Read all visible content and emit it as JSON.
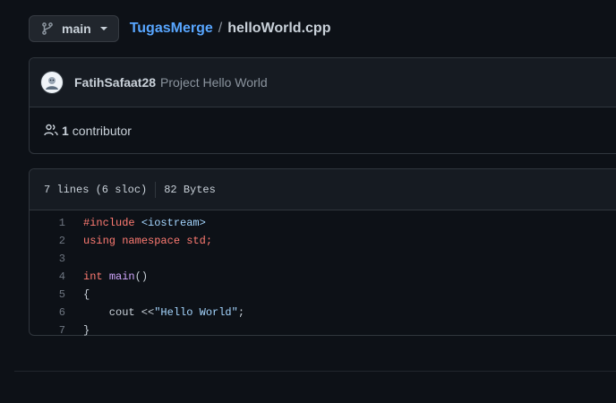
{
  "branch": {
    "name": "main"
  },
  "breadcrumb": {
    "repo": "TugasMerge",
    "separator": "/",
    "file": "helloWorld.cpp"
  },
  "commit": {
    "author": "FatihSafaat28",
    "message": "Project Hello World"
  },
  "contributors": {
    "count": "1",
    "label": "contributor"
  },
  "file_info": {
    "lines": "7 lines (6 sloc)",
    "size": "82 Bytes"
  },
  "code": {
    "line_numbers": [
      "1",
      "2",
      "3",
      "4",
      "5",
      "6",
      "7"
    ],
    "l1": {
      "kw": "#include",
      "sp": " ",
      "inc": "<iostream>"
    },
    "l2": {
      "kw1": "using",
      "sp1": " ",
      "kw2": "namespace",
      "sp2": " ",
      "rest": "std;"
    },
    "l3": {
      "text": ""
    },
    "l4": {
      "kw": "int",
      "sp": " ",
      "fn": "main",
      "rest": "()"
    },
    "l5": {
      "text": "{"
    },
    "l6": {
      "pre": "    cout <<",
      "str": "\"Hello World\"",
      "rest": ";"
    },
    "l7": {
      "text": "}"
    }
  },
  "colors": {
    "background": "#0d1117",
    "link": "#58a6ff",
    "keyword": "#ff7b72",
    "string": "#a5d6ff",
    "function": "#d2a8ff"
  }
}
